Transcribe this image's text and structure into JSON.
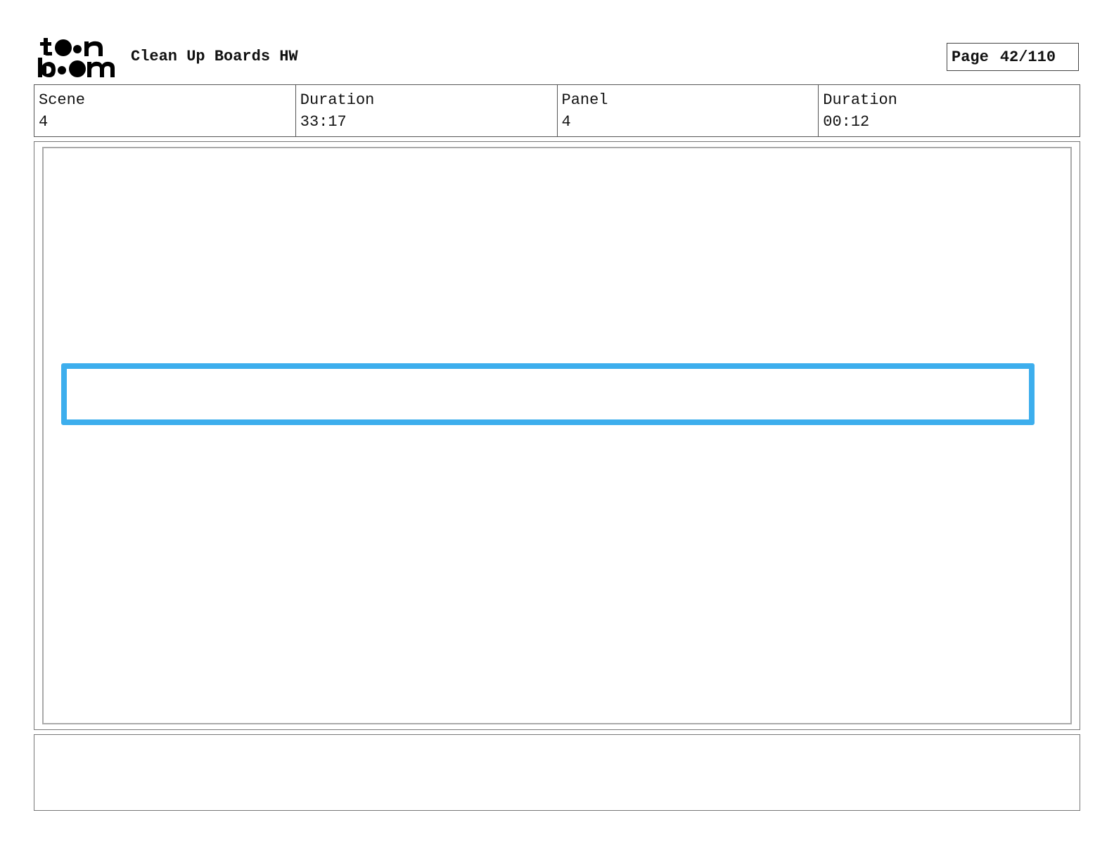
{
  "header": {
    "logo_text_top": "toon",
    "logo_text_bottom": "boom",
    "title": "Clean Up Boards HW",
    "page_label": "Page",
    "page_value": "42/110"
  },
  "info": {
    "scene_label": "Scene",
    "scene_value": "4",
    "scene_duration_label": "Duration",
    "scene_duration_value": "33:17",
    "panel_label": "Panel",
    "panel_value": "4",
    "panel_duration_label": "Duration",
    "panel_duration_value": "00:12"
  },
  "panel": {
    "stroke_color": "#3daeed"
  },
  "notes": {
    "text": ""
  }
}
